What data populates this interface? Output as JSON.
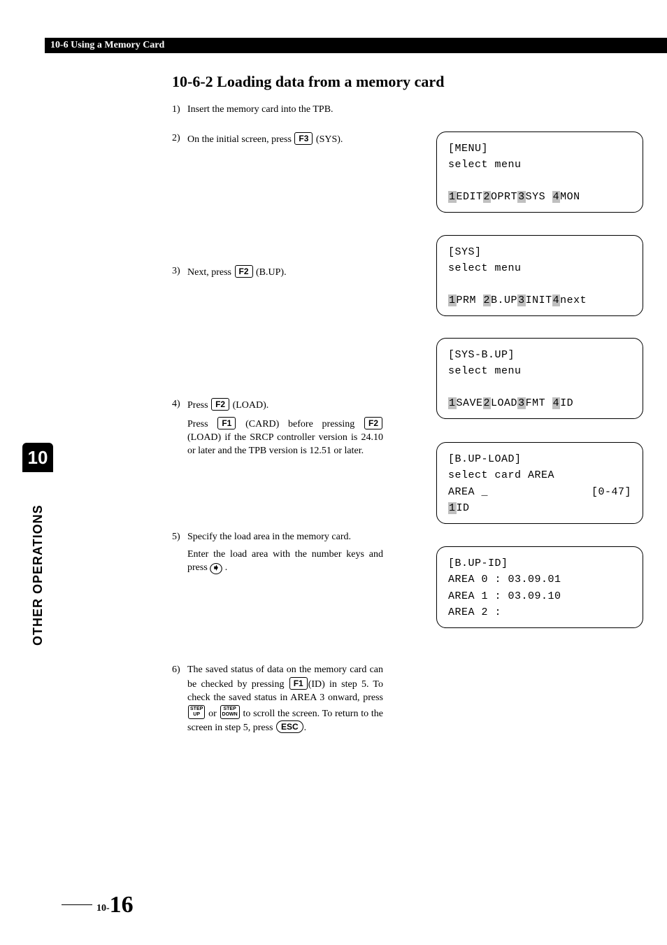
{
  "header": {
    "breadcrumb": "10-6 Using a Memory Card"
  },
  "section": {
    "title": "10-6-2  Loading data from a memory card"
  },
  "steps": {
    "s1": {
      "num": "1)",
      "text": "Insert the memory card into the TPB."
    },
    "s2": {
      "num": "2)",
      "prefix": "On the initial screen, press ",
      "key": "F3",
      "suffix": " (SYS)."
    },
    "s3": {
      "num": "3)",
      "prefix": "Next, press ",
      "key": "F2",
      "suffix": " (B.UP)."
    },
    "s4": {
      "num": "4)",
      "prefix": "Press ",
      "key": "F2",
      "suffix": " (LOAD).",
      "sub_a": "Press ",
      "sub_key1": "F1",
      "sub_b": " (CARD) before pressing ",
      "sub_key2": "F2",
      "sub_c": " (LOAD) if the SRCP controller version is 24.10 or later and the TPB version is 12.51 or later."
    },
    "s5": {
      "num": "5)",
      "line1": "Specify the load area in the memory card.",
      "line2a": "Enter the load area with the number keys and press ",
      "line2b": " ."
    },
    "s6": {
      "num": "6)",
      "a": "The saved status of data on the memory card can be checked by pressing ",
      "key1": "F1",
      "b": "(ID) in step 5. To check the saved status in AREA 3 onward, press ",
      "stepup_top": "STEP",
      "stepup_bot": "UP",
      "c": " or ",
      "stepdn_top": "STEP",
      "stepdn_bot": "DOWN",
      "d": " to scroll the screen. To return to the screen in step 5, press ",
      "esc": "ESC",
      "e": "."
    }
  },
  "screens": {
    "menu": {
      "title": "[MENU]",
      "line2": "select menu",
      "fn": {
        "n1": "1",
        "l1": "EDIT",
        "n2": "2",
        "l2": "OPRT",
        "n3": "3",
        "l3": "SYS ",
        "n4": "4",
        "l4": "MON"
      }
    },
    "sys": {
      "title": "[SYS]",
      "line2": "select menu",
      "fn": {
        "n1": "1",
        "l1": "PRM ",
        "n2": "2",
        "l2": "B.UP",
        "n3": "3",
        "l3": "INIT",
        "n4": "4",
        "l4": "next"
      }
    },
    "bup": {
      "title": "[SYS-B.UP]",
      "line2": "select menu",
      "fn": {
        "n1": "1",
        "l1": "SAVE",
        "n2": "2",
        "l2": "LOAD",
        "n3": "3",
        "l3": "FMT ",
        "n4": "4",
        "l4": "ID"
      }
    },
    "load": {
      "title": "[B.UP-LOAD]",
      "line2": "select card AREA",
      "line3a": "AREA _",
      "line3b": "[0-47]",
      "fn": {
        "n1": "1",
        "l1": "ID"
      }
    },
    "id": {
      "title": "[B.UP-ID]",
      "l1": "AREA 0 : 03.09.01",
      "l2": "AREA 1 : 03.09.10",
      "l3": "AREA 2 :"
    }
  },
  "sidebar": {
    "chapter": "10",
    "label": "OTHER OPERATIONS"
  },
  "pagenum": {
    "prefix": "10-",
    "num": "16"
  }
}
